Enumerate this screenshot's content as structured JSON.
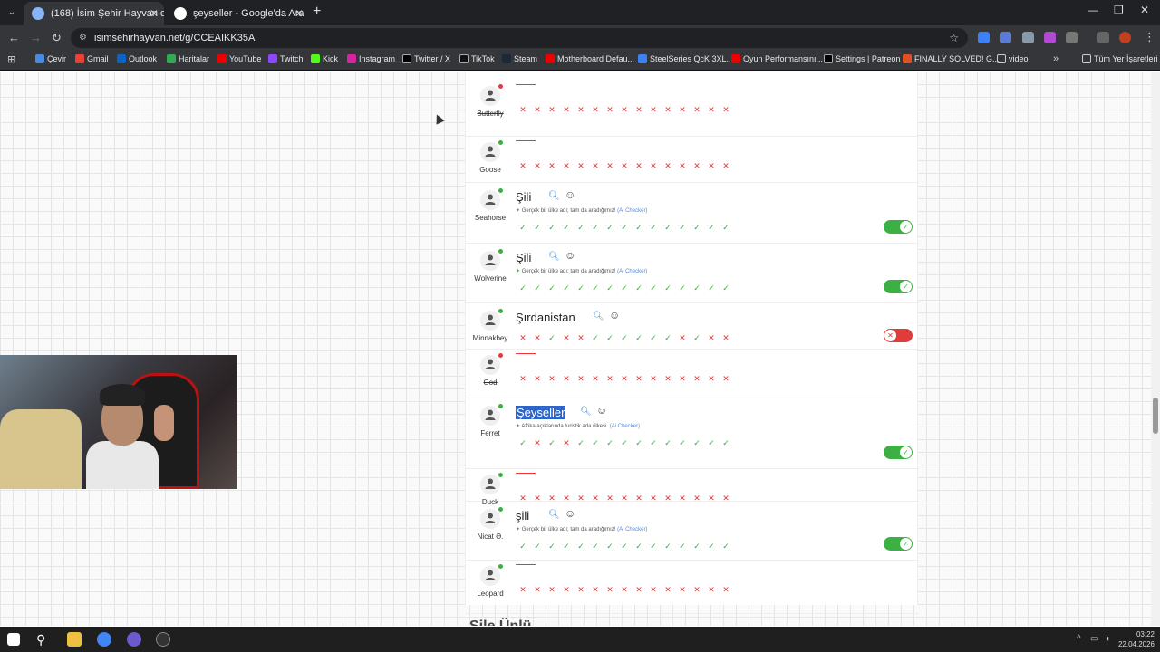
{
  "browser": {
    "tabs": [
      {
        "title": "(168) İsim Şehir Hayvan oyunun",
        "close": "✕"
      },
      {
        "title": "şeyseller - Google'da Ara",
        "close": "✕"
      }
    ],
    "new_tab": "+",
    "url": "isimsehirhayvan.net/g/CCEAIKK35A",
    "bookmarks": [
      "Çevir",
      "Gmail",
      "Outlook",
      "Haritalar",
      "YouTube",
      "Twitch",
      "Kick",
      "Instagram",
      "Twitter / X",
      "TikTok",
      "Steam",
      "Motherboard Defau...",
      "SteelSeries QcK 3XL...",
      "Oyun Performansını...",
      "Settings | Patreon",
      "FINALLY SOLVED! G...",
      "video"
    ],
    "bookmarks_more": "»",
    "all_bookmarks": "Tüm Yer İşaretleri"
  },
  "players": [
    {
      "name": "Butterfly",
      "strike": true,
      "status": "red",
      "answer": "",
      "note": "",
      "ai": "",
      "votes": "xxxxxxxxxxxxxxx",
      "toggle": null
    },
    {
      "name": "Goose",
      "strike": false,
      "status": "green",
      "answer": "",
      "note": "",
      "ai": "",
      "votes": "xxxxxxxxxxxxxxx",
      "toggle": null
    },
    {
      "name": "Seahorse",
      "strike": false,
      "status": "green",
      "answer": "Şili",
      "note": "Gerçek bir ülke adı; tam da aradığımız!",
      "ai": "(Ai Checker)",
      "votes": "ccccccccccccccc",
      "toggle": "on"
    },
    {
      "name": "Wolverine",
      "strike": false,
      "status": "green",
      "answer": "Şili",
      "note": "Gerçek bir ülke adı; tam da aradığımız!",
      "ai": "(Ai Checker)",
      "votes": "ccccccccccccccc",
      "toggle": "on"
    },
    {
      "name": "Minnakbey",
      "strike": false,
      "status": "green",
      "answer": "Şırdanistan",
      "note": "",
      "ai": "",
      "votes": "xxcxxccccccxcxx",
      "toggle": "off"
    },
    {
      "name": "God",
      "strike": true,
      "status": "red",
      "answer": "",
      "note": "",
      "ai": "",
      "votes": "xxxxxxxxxxxxxxx",
      "toggle": null
    },
    {
      "name": "Ferret",
      "strike": false,
      "status": "green",
      "answer": "Şeyseller",
      "highlight": true,
      "note": "Afrika açıklarında turistik ada ülkesi.",
      "ai": "(Ai Checker)",
      "votes": "cxcxccccccccccc",
      "toggle": "on"
    },
    {
      "name": "Duck",
      "strike": false,
      "status": "green",
      "answer": "",
      "note": "",
      "ai": "",
      "votes": "xxxxxxxxxxxxxxx",
      "toggle": null
    },
    {
      "name": "Nicat Ə.",
      "strike": false,
      "status": "green",
      "answer": "şili",
      "note": "Gerçek bir ülke adı; tam da aradığımız!",
      "ai": "(Ai Checker)",
      "votes": "ccccccccccccccc",
      "toggle": "on"
    },
    {
      "name": "Leopard",
      "strike": false,
      "status": "green",
      "answer": "",
      "note": "",
      "ai": "",
      "votes": "xxxxxxxxxxxxxxx",
      "toggle": null
    }
  ],
  "next_section_title": "Şile Ünlü",
  "taskbar": {
    "time": "03:22",
    "date": "22.04.2026"
  },
  "colors": {
    "accent": "#2f64c8",
    "ok": "#3cb043",
    "bad": "#e03c3c"
  }
}
